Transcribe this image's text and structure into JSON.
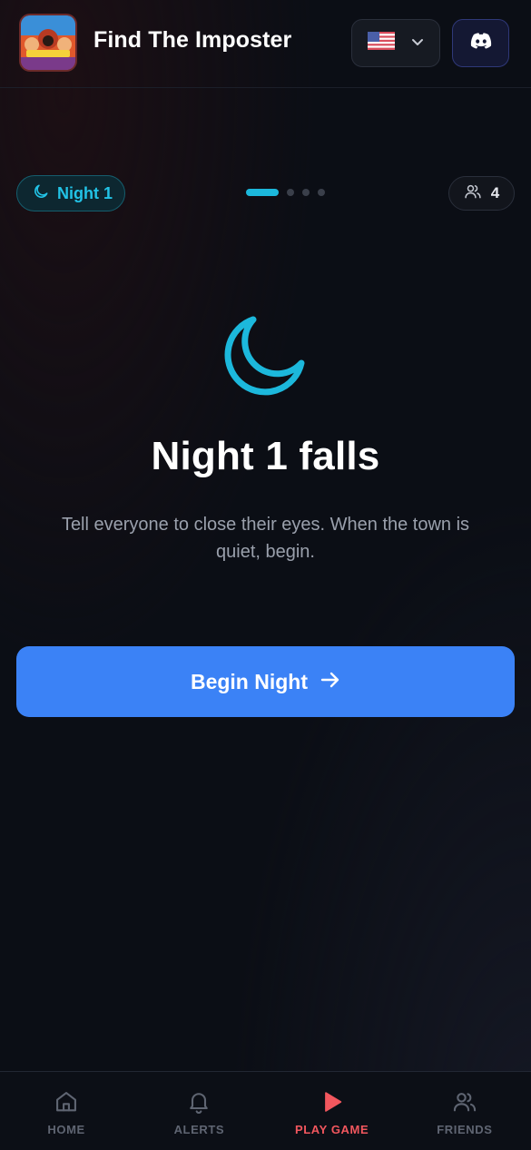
{
  "header": {
    "app_title": "Find The Imposter",
    "logo_icon": "game-logo-icon",
    "language_flag": "us-flag-icon",
    "discord_icon": "discord-icon"
  },
  "status": {
    "night_label": "Night 1",
    "step_current": 1,
    "step_total": 4,
    "player_count": "4"
  },
  "main": {
    "headline": "Night 1 falls",
    "description": "Tell everyone to close their eyes. When the town is quiet, begin.",
    "begin_button_label": "Begin Night"
  },
  "nav": {
    "items": [
      {
        "label": "HOME",
        "icon": "home-icon"
      },
      {
        "label": "ALERTS",
        "icon": "bell-icon"
      },
      {
        "label": "PLAY GAME",
        "icon": "play-icon"
      },
      {
        "label": "FRIENDS",
        "icon": "friends-icon"
      }
    ],
    "active_index": 2
  },
  "colors": {
    "accent_cyan": "#1cb8dc",
    "primary_blue": "#3b82f6",
    "active_nav": "#f2575e",
    "background": "#0b0e15"
  }
}
